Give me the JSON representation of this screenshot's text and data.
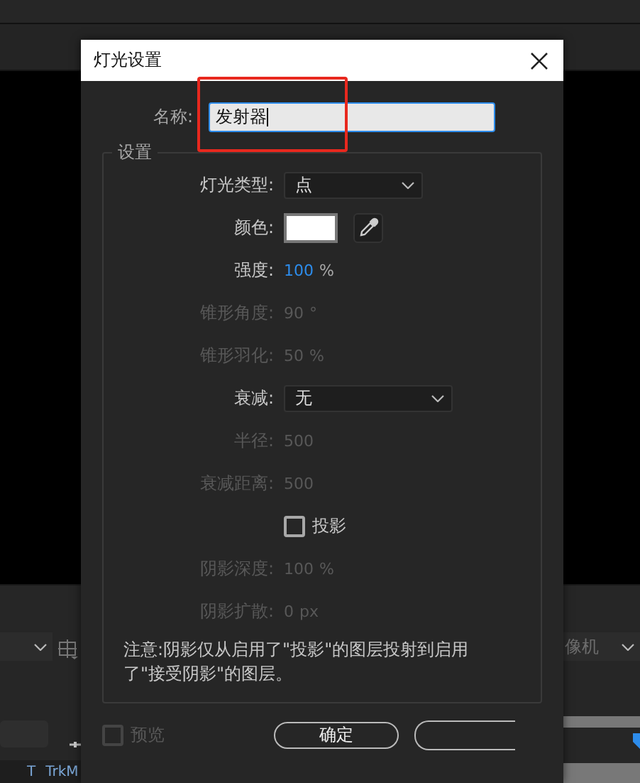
{
  "background": {
    "right_dropdown": {
      "value": "像机"
    },
    "bottom_bar": [
      "T",
      "TrkM"
    ]
  },
  "dialog": {
    "title": "灯光设置",
    "name_field": {
      "label": "名称:",
      "value": "发射器"
    },
    "settings": {
      "legend": "设置",
      "rows": [
        {
          "kind": "dropdown",
          "label": "灯光类型:",
          "value": "点",
          "disabled": false
        },
        {
          "kind": "color",
          "label": "颜色:",
          "color": "#ffffff",
          "disabled": false
        },
        {
          "kind": "value",
          "label": "强度:",
          "value": "100",
          "unit": "%",
          "disabled": false
        },
        {
          "kind": "value",
          "label": "锥形角度:",
          "value": "90",
          "unit": "°",
          "disabled": true
        },
        {
          "kind": "value",
          "label": "锥形羽化:",
          "value": "50",
          "unit": "%",
          "disabled": true
        },
        {
          "kind": "dropdown",
          "label": "衰减:",
          "value": "无",
          "disabled": false
        },
        {
          "kind": "value",
          "label": "半径:",
          "value": "500",
          "disabled": true
        },
        {
          "kind": "value",
          "label": "衰减距离:",
          "value": "500",
          "disabled": true
        },
        {
          "kind": "checkbox",
          "label": "投影",
          "checked": false,
          "disabled": false
        },
        {
          "kind": "value",
          "label": "阴影深度:",
          "value": "100",
          "unit": "%",
          "disabled": true
        },
        {
          "kind": "value",
          "label": "阴影扩散:",
          "value": "0",
          "unit": "px",
          "disabled": true
        }
      ],
      "note": "注意:阴影仅从启用了\"投影\"的图层投射到启用了\"接受阴影\"的图层。"
    },
    "preview": {
      "label": "预览",
      "checked": false,
      "disabled": true
    },
    "buttons": [
      {
        "label": "确定"
      },
      {
        "kind": "blank"
      }
    ]
  },
  "annotation": {
    "kind": "highlight",
    "color": "#e8281e"
  }
}
